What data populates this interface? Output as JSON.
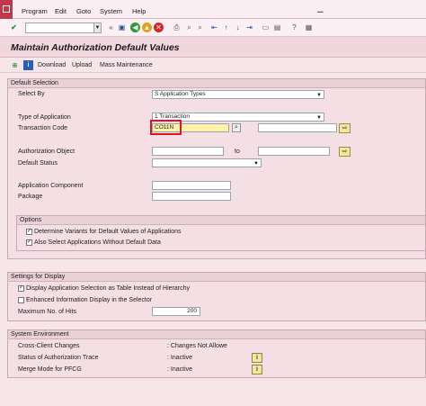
{
  "menu": [
    "Program",
    "Edit",
    "Goto",
    "System",
    "Help"
  ],
  "title": "Maintain Authorization Default Values",
  "app_toolbar": {
    "download": "Download",
    "upload": "Upload",
    "mass": "Mass Maintenance"
  },
  "default_selection": {
    "header": "Default Selection",
    "select_by_label": "Select By",
    "select_by_value": "S Application Types",
    "type_label": "Type of Application",
    "type_value": "1 Transaction",
    "tcode_label": "Transaction Code",
    "tcode_value": "CO11N",
    "auth_obj_label": "Authorization Object",
    "to_label": "to",
    "status_label": "Default Status",
    "app_comp_label": "Application Component",
    "package_label": "Package"
  },
  "options": {
    "header": "Options",
    "opt1": "Determine Variants for Default Values of Applications",
    "opt2": "Also Select Applications Without Default Data"
  },
  "display": {
    "header": "Settings for Display",
    "opt1": "Display Application Selection as Table Instead of Hierarchy",
    "opt2": "Enhanced Information Display in the Selector",
    "maxhits_label": "Maximum No. of Hits",
    "maxhits_value": "200"
  },
  "system": {
    "header": "System Environment",
    "row1_label": "Cross-Client Changes",
    "row1_value": ": Changes Not Allowe",
    "row2_label": "Status of Authorization Trace",
    "row2_value": ": Inactive",
    "row3_label": "Merge Mode for PFCG",
    "row3_value": ": Inactive"
  },
  "colors": {
    "accent": "#c0394b",
    "highlight": "#e0141f",
    "background": "#f6e6ea"
  }
}
